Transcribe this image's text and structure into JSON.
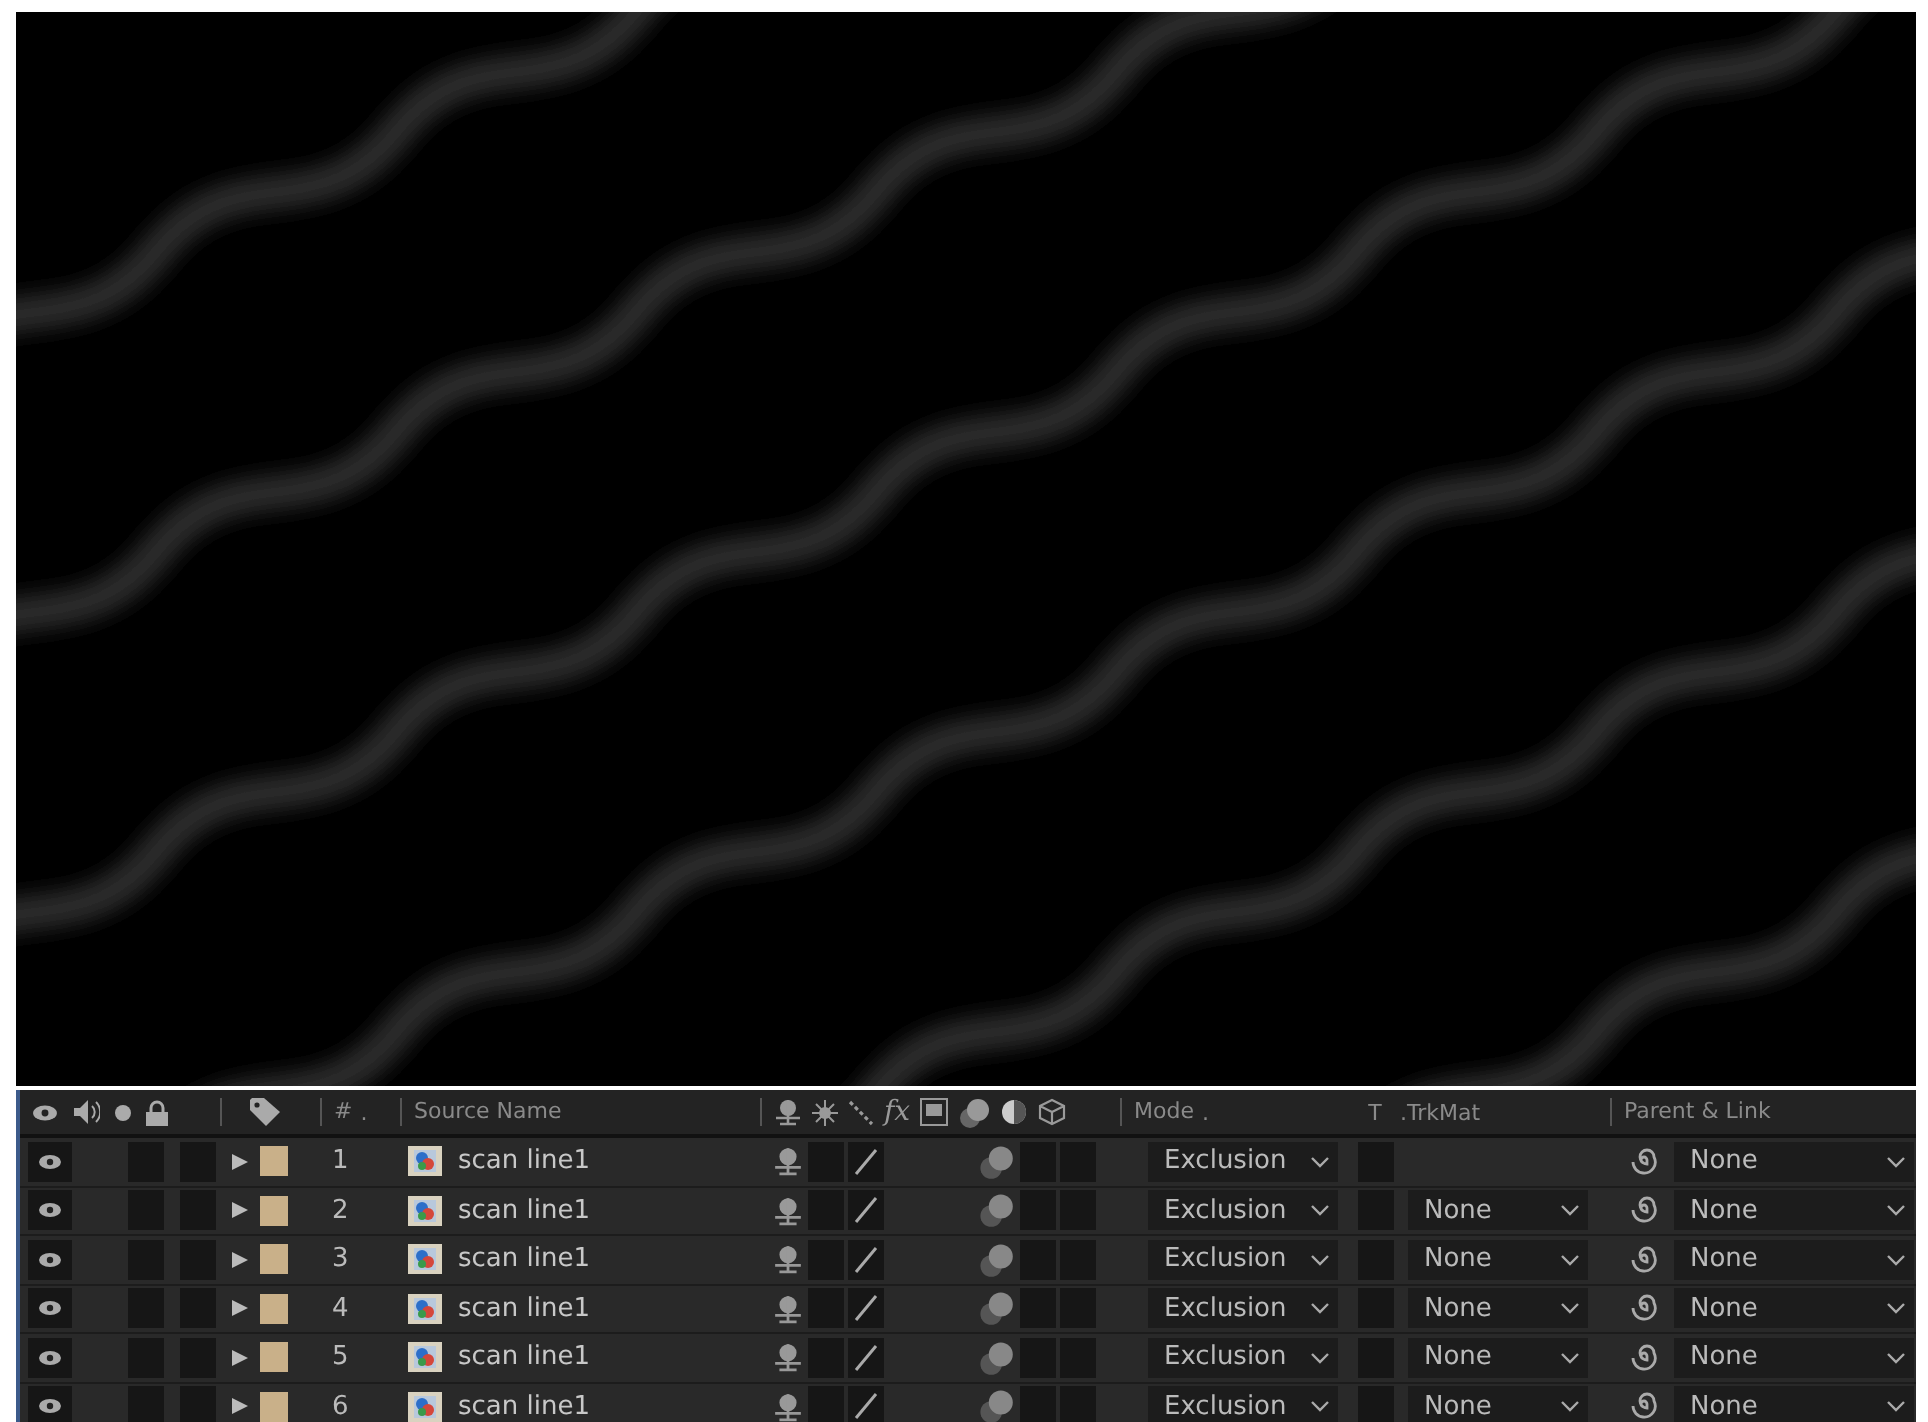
{
  "timeline": {
    "columns": [
      {
        "kind": "number",
        "label": "#",
        "mark": "."
      },
      {
        "kind": "source",
        "label": "Source Name"
      },
      {
        "kind": "switches",
        "fx": "fx"
      },
      {
        "kind": "mode",
        "label": "Mode",
        "mark": "."
      },
      {
        "kind": "t",
        "label": "T"
      },
      {
        "kind": "trkmat",
        "label": ".TrkMat"
      },
      {
        "kind": "parent",
        "label": "Parent & Link"
      }
    ],
    "rows": [
      {
        "visible": true,
        "number": "1",
        "name": "scan line1",
        "color": "#c9b089",
        "mode": "Exclusion",
        "parent": "None"
      },
      {
        "visible": true,
        "number": "2",
        "name": "scan line1",
        "color": "#c9b089",
        "mode": "Exclusion",
        "track_matte": "None",
        "parent": "None"
      },
      {
        "visible": true,
        "number": "3",
        "name": "scan line1",
        "color": "#c9b089",
        "mode": "Exclusion",
        "track_matte": "None",
        "parent": "None"
      },
      {
        "visible": true,
        "number": "4",
        "name": "scan line1",
        "color": "#c9b089",
        "mode": "Exclusion",
        "track_matte": "None",
        "parent": "None"
      },
      {
        "visible": true,
        "number": "5",
        "name": "scan line1",
        "color": "#c9b089",
        "mode": "Exclusion",
        "track_matte": "None",
        "parent": "None"
      },
      {
        "visible": true,
        "number": "6",
        "name": "scan line1",
        "color": "#c9b089",
        "mode": "Exclusion",
        "track_matte": "None",
        "parent": "None"
      }
    ]
  }
}
